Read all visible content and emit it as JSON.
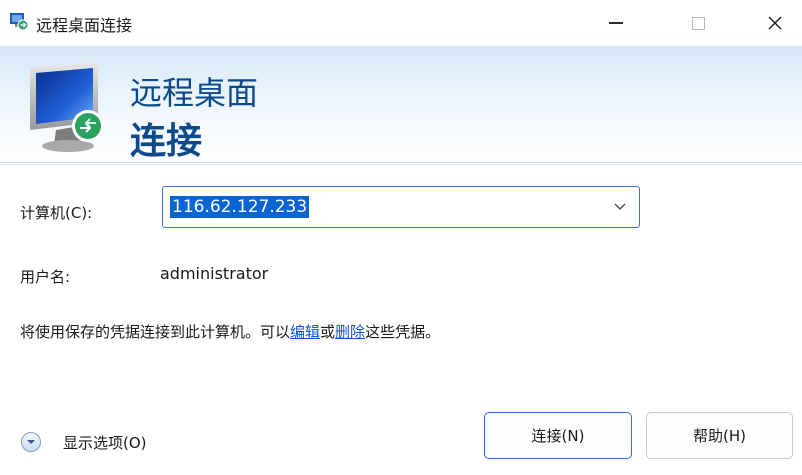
{
  "window": {
    "title": "远程桌面连接",
    "icon": "remote-desktop-icon",
    "controls": {
      "minimize": "minimize-icon",
      "maximize": "maximize-icon",
      "close": "close-icon"
    }
  },
  "banner": {
    "line1": "远程桌面",
    "line2": "连接",
    "icon": "remote-desktop-monitor-icon"
  },
  "form": {
    "computer_label": "计算机(C):",
    "computer_value": "116.62.127.233",
    "username_label": "用户名:",
    "username_value": "administrator",
    "info_before": "将使用保存的凭据连接到此计算机。可以",
    "info_edit_link": "编辑",
    "info_or": "或",
    "info_delete_link": "删除",
    "info_after": "这些凭据。"
  },
  "footer": {
    "show_options_label": "显示选项(O)",
    "connect_button": "连接(N)",
    "help_button": "帮助(H)"
  },
  "colors": {
    "accent": "#0a64d2",
    "link": "#0b57d0",
    "banner_text": "#0e4a8a"
  }
}
